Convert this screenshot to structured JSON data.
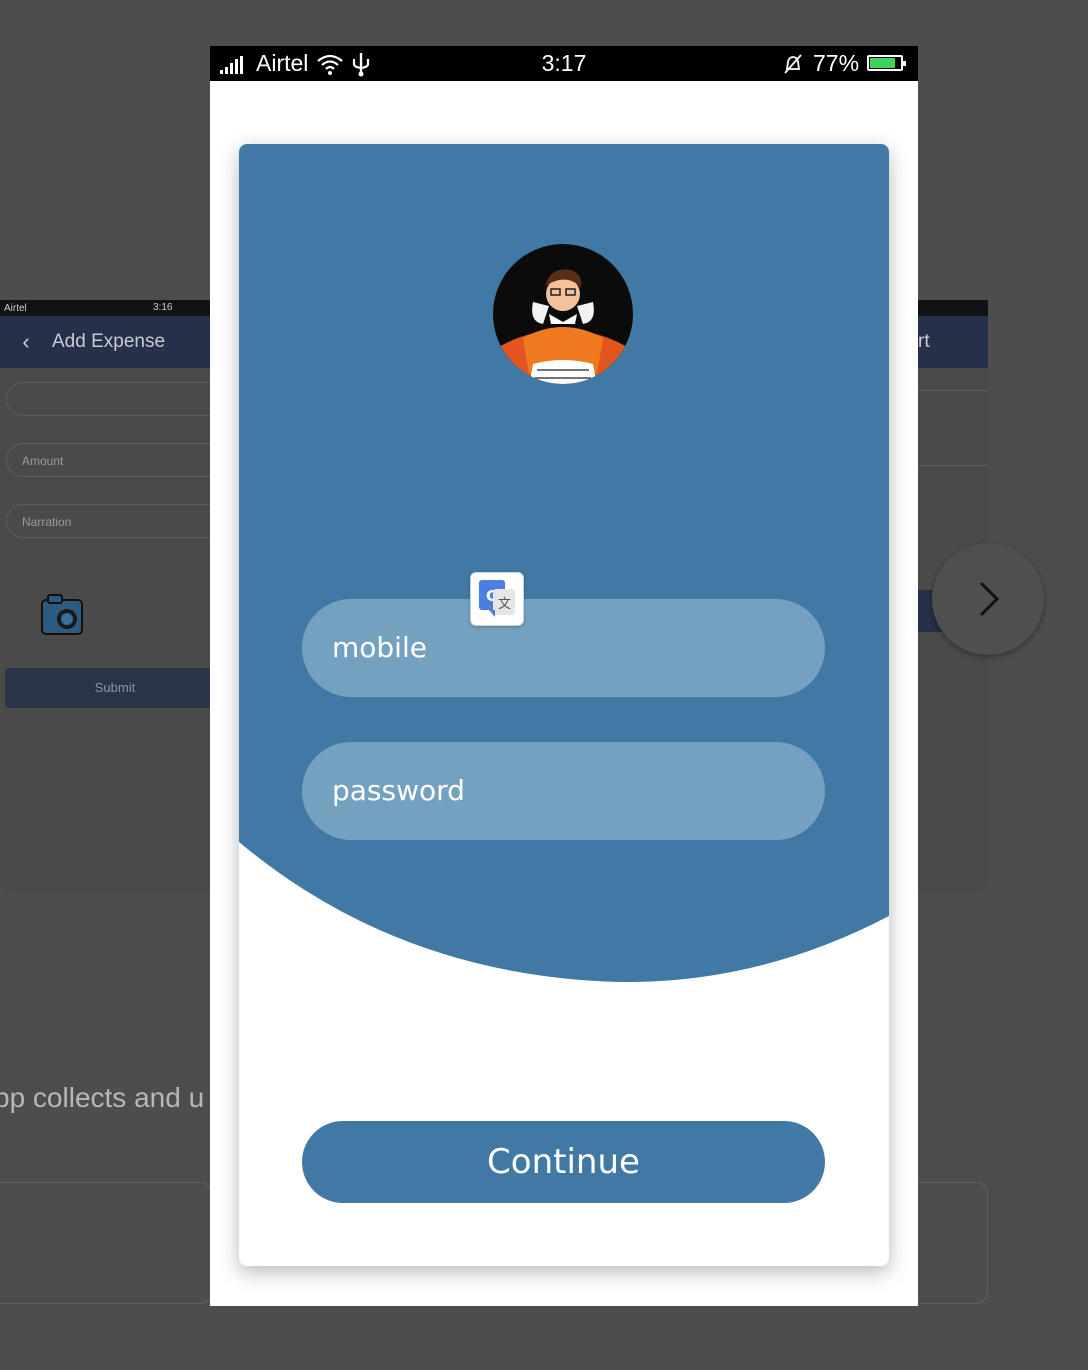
{
  "background_left": {
    "status_time": "3:16",
    "status_carrier": "Airtel",
    "title": "Add Expense",
    "amount_placeholder": "Amount",
    "narration_placeholder": "Narration",
    "submit_label": "Submit"
  },
  "background_right": {
    "title_fragment": "rt"
  },
  "background_text": "pp collects and u",
  "status_bar": {
    "carrier": "Airtel",
    "time": "3:17",
    "battery": "77%"
  },
  "login": {
    "mobile_placeholder": "mobile",
    "password_placeholder": "password",
    "continue_label": "Continue"
  },
  "colors": {
    "primary": "#4179a5",
    "input_fill": "#75a1c1",
    "battery": "#3ed35a"
  },
  "icons": [
    "signal-icon",
    "wifi-icon",
    "usb-icon",
    "bell-muted-icon",
    "battery-icon",
    "avatar-icon",
    "translate-icon",
    "chevron-right-icon",
    "camera-icon",
    "back-arrow-icon"
  ]
}
